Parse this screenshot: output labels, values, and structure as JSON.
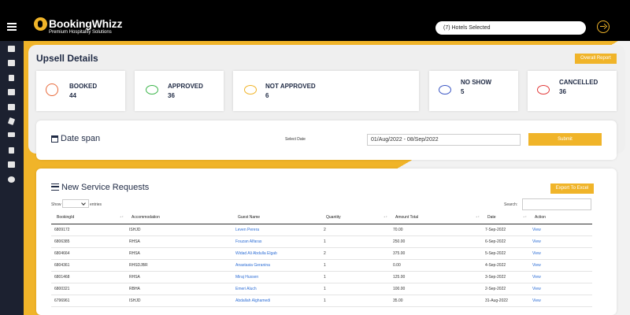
{
  "brand": {
    "name": "BookingWhizz",
    "tagline": "Premium Hospitality Solutions"
  },
  "header": {
    "hotel_selector": "(7) Hotels Selected"
  },
  "sidebar": {
    "icons": [
      "home-icon",
      "team-icon",
      "document-icon",
      "chart-icon",
      "checkbox-icon",
      "send-icon",
      "line-chart-icon",
      "filter-icon",
      "group-icon",
      "whatsapp-icon"
    ]
  },
  "page": {
    "title": "Upsell Details",
    "overall_report": "Overall Report"
  },
  "stats": [
    {
      "label": "BOOKED",
      "value": "44",
      "color": "#e8693a"
    },
    {
      "label": "APPROVED",
      "value": "36",
      "color": "#3bb54a"
    },
    {
      "label": "NOT APPROVED",
      "value": "6",
      "color": "#f0b429"
    },
    {
      "label": "NO SHOW",
      "value": "5",
      "color": "#3b57c4"
    },
    {
      "label": "CANCELLED",
      "value": "36",
      "color": "#e23b3b"
    }
  ],
  "date_span": {
    "title": "Date span",
    "select_label": "Select Date",
    "value": "01/Aug/2022 - 08/Sep/2022",
    "submit": "Submit"
  },
  "requests": {
    "title": "New Service Requests",
    "export": "Export To Excel",
    "show_label": "Show",
    "entries_label": "entries",
    "search_label": "Search:",
    "columns": [
      "BookingId",
      "Accommodation",
      "Guest Name",
      "Quantity",
      "Amount Total",
      "Date",
      "Action"
    ],
    "rows": [
      [
        "6809172",
        "ISHJD",
        "Leven Perera",
        "2",
        "70.00",
        "7-Sep-2022",
        "View"
      ],
      [
        "6806385",
        "RHSA",
        "Fouzan Alfaras",
        "1",
        "250.00",
        "6-Sep-2022",
        "View"
      ],
      [
        "6804664",
        "RHSA",
        "Widad Ali Abdulla Elgab",
        "2",
        "375.00",
        "5-Sep-2022",
        "View"
      ],
      [
        "6804361",
        "RHSDJBR",
        "Anastasia Geranina",
        "1",
        "0.00",
        "4-Sep-2022",
        "View"
      ],
      [
        "6801468",
        "RHSA",
        "Miraj Hussen",
        "1",
        "125.00",
        "3-Sep-2022",
        "View"
      ],
      [
        "6800321",
        "RBHA",
        "Emeri Aluch",
        "1",
        "100.00",
        "2-Sep-2022",
        "View"
      ],
      [
        "6796961",
        "ISHJD",
        "Abdallah Alghamedi",
        "1",
        "35.00",
        "31-Aug-2022",
        "View"
      ]
    ]
  }
}
